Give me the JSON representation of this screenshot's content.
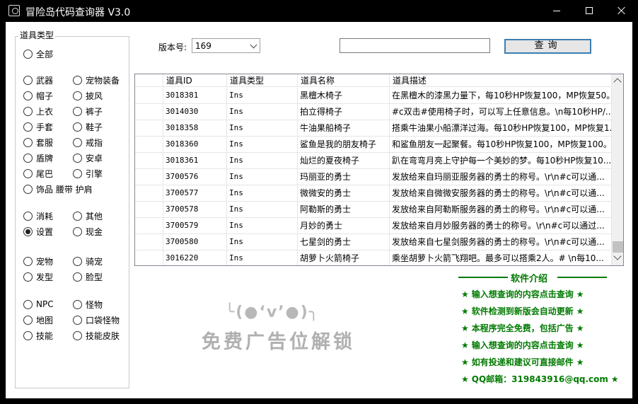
{
  "window": {
    "title": "冒险岛代码查询器 V3.0"
  },
  "sidebar": {
    "group_title": "道具类型",
    "radios": [
      {
        "label": "全部",
        "checked": false
      },
      {
        "label": "武器",
        "checked": false
      },
      {
        "label": "宠物装备",
        "checked": false
      },
      {
        "label": "帽子",
        "checked": false
      },
      {
        "label": "披风",
        "checked": false
      },
      {
        "label": "上衣",
        "checked": false
      },
      {
        "label": "裤子",
        "checked": false
      },
      {
        "label": "手套",
        "checked": false
      },
      {
        "label": "鞋子",
        "checked": false
      },
      {
        "label": "套服",
        "checked": false
      },
      {
        "label": "戒指",
        "checked": false
      },
      {
        "label": "盾牌",
        "checked": false
      },
      {
        "label": "安卓",
        "checked": false
      },
      {
        "label": "尾巴",
        "checked": false
      },
      {
        "label": "引擎",
        "checked": false
      },
      {
        "label": "饰品 腰带 护肩",
        "checked": false
      },
      {
        "label": "消耗",
        "checked": false
      },
      {
        "label": "其他",
        "checked": false
      },
      {
        "label": "设置",
        "checked": true
      },
      {
        "label": "现金",
        "checked": false
      },
      {
        "label": "宠物",
        "checked": false
      },
      {
        "label": "骑宠",
        "checked": false
      },
      {
        "label": "发型",
        "checked": false
      },
      {
        "label": "脸型",
        "checked": false
      },
      {
        "label": "NPC",
        "checked": false
      },
      {
        "label": "怪物",
        "checked": false
      },
      {
        "label": "地图",
        "checked": false
      },
      {
        "label": "口袋怪物",
        "checked": false
      },
      {
        "label": "技能",
        "checked": false
      },
      {
        "label": "技能皮肤",
        "checked": false
      }
    ]
  },
  "toolbar": {
    "version_label": "版本号:",
    "version_value": "169",
    "search_value": "",
    "query_label": "查询"
  },
  "table": {
    "headers": [
      "",
      "道具ID",
      "道具类型",
      "道具名称",
      "道具描述"
    ],
    "rows": [
      [
        "3018381",
        "Ins",
        "黑檀木椅子",
        "在黑檀木的漆黑力量下，每10秒HP恢复100，MP恢复50。"
      ],
      [
        "3014030",
        "Ins",
        "拍立得椅子",
        "#c双击#使用椅子时，可以写上任意信息。\\n每10秒HP/..."
      ],
      [
        "3018358",
        "Ins",
        "牛油果船椅子",
        "搭乘牛油果小船漂洋过海。每10秒HP恢复100，MP恢复1..."
      ],
      [
        "3018360",
        "Ins",
        "鲨鱼是我的朋友椅子",
        "和鲨鱼朋友一起聚餐。每10秒HP恢复100，MP恢复100。"
      ],
      [
        "3018361",
        "Ins",
        "灿烂的夏夜椅子",
        "趴在弯弯月亮上守护每一个美妙的梦。每10秒HP恢复10..."
      ],
      [
        "3700576",
        "Ins",
        "玛丽亚的勇士",
        "发放给来自玛丽亚服务器的勇士的称号。\\r\\n#c可以通..."
      ],
      [
        "3700577",
        "Ins",
        "微微安的勇士",
        "发放给来自微微安服务器的勇士的称号。\\r\\n#c可以通..."
      ],
      [
        "3700578",
        "Ins",
        "阿勒斯的勇士",
        "发放给来自阿勒斯服务器的勇士的称号。\\r\\n#c可以通..."
      ],
      [
        "3700579",
        "Ins",
        "月妙的勇士",
        "发放给来自月妙服务器的勇士的称号。\\r\\n#c可以通过..."
      ],
      [
        "3700580",
        "Ins",
        "七星剑的勇士",
        "发放给来自七星剑服务器的勇士的称号。\\r\\n#c可以通..."
      ],
      [
        "3016220",
        "Ins",
        "胡萝卜火箭椅子",
        "乘坐胡萝卜火箭飞翔吧。最多可以搭乘2人。# \\n每10..."
      ]
    ]
  },
  "ad": {
    "face": "╰(●‘v’●)╮",
    "text": "免费广告位解锁"
  },
  "info": {
    "title": "软件介绍",
    "items": [
      "输入想查询的内容点击查询",
      "软件检测到新版会自动更新",
      "本程序完全免费，包括广告",
      "输入想查询的内容点击查询",
      "如有投递和建议可直接邮件",
      "QQ邮箱：319843916@qq.com"
    ],
    "color": "#007a00"
  }
}
